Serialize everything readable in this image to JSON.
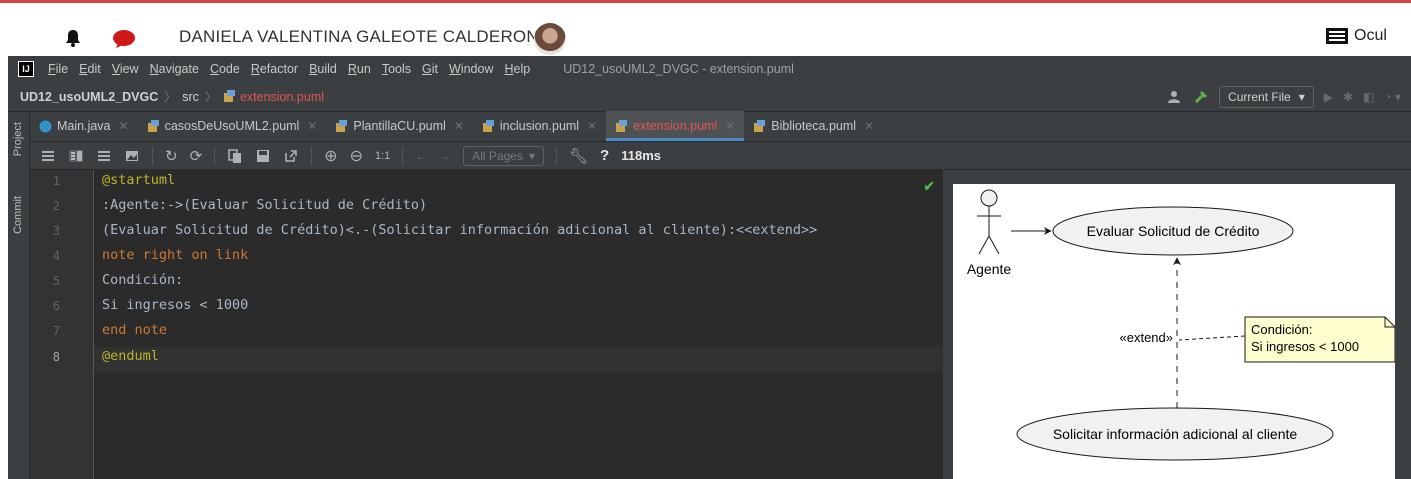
{
  "host_bar": {
    "user_name": "DANIELA VALENTINA GALEOTE CALDERON",
    "hide_label": "Ocul",
    "icons": [
      "bell-icon",
      "chat-bubble-icon",
      "hide-panel-icon"
    ],
    "accent_color": "#d64545"
  },
  "menubar": {
    "items": [
      "File",
      "Edit",
      "View",
      "Navigate",
      "Code",
      "Refactor",
      "Build",
      "Run",
      "Tools",
      "Git",
      "Window",
      "Help"
    ],
    "window_title": "UD12_usoUML2_DVGC - extension.puml"
  },
  "navbar": {
    "project": "UD12_usoUML2_DVGC",
    "folder": "src",
    "file": "extension.puml",
    "run_config": "Current File"
  },
  "sidebar": {
    "tabs": [
      "Project",
      "Commit"
    ]
  },
  "tabs": [
    {
      "label": "Main.java",
      "icon": "java-class-icon",
      "active": false
    },
    {
      "label": "casosDeUsoUML2.puml",
      "icon": "puml-file-icon",
      "active": false
    },
    {
      "label": "PlantillaCU.puml",
      "icon": "puml-file-icon",
      "active": false
    },
    {
      "label": "inclusion.puml",
      "icon": "puml-file-icon",
      "active": false
    },
    {
      "label": "extension.puml",
      "icon": "puml-file-icon",
      "active": true
    },
    {
      "label": "Biblioteca.puml",
      "icon": "puml-file-icon",
      "active": false
    }
  ],
  "toolbar": {
    "zoom_reset": "1:1",
    "pages_select": "All Pages",
    "help": "?",
    "render_time": "118ms"
  },
  "editor": {
    "current_line": 8,
    "lines": [
      {
        "n": "1",
        "text": "@startuml",
        "style": "ann"
      },
      {
        "n": "2",
        "text": ":Agente:->(Evaluar Solicitud de Crédito)",
        "style": "plain"
      },
      {
        "n": "3",
        "text": "(Evaluar Solicitud de Crédito)<.-(Solicitar información adicional al cliente):<<extend>>",
        "style": "plain"
      },
      {
        "n": "4",
        "text": "note right on link",
        "style": "kw"
      },
      {
        "n": "5",
        "text": "Condición:",
        "style": "plain"
      },
      {
        "n": "6",
        "text": "Si ingresos < 1000",
        "style": "plain"
      },
      {
        "n": "7",
        "text": "end note",
        "style": "kw"
      },
      {
        "n": "8",
        "text": "@enduml",
        "style": "ann"
      }
    ]
  },
  "diagram": {
    "actor": "Agente",
    "usecase_top": "Evaluar Solicitud de Crédito",
    "usecase_bottom": "Solicitar información adicional al cliente",
    "stereotype": "«extend»",
    "note_line1": "Condición:",
    "note_line2": "Si ingresos < 1000",
    "colors": {
      "usecase_fill": "#f1f1f1",
      "note_fill": "#fefece"
    }
  }
}
